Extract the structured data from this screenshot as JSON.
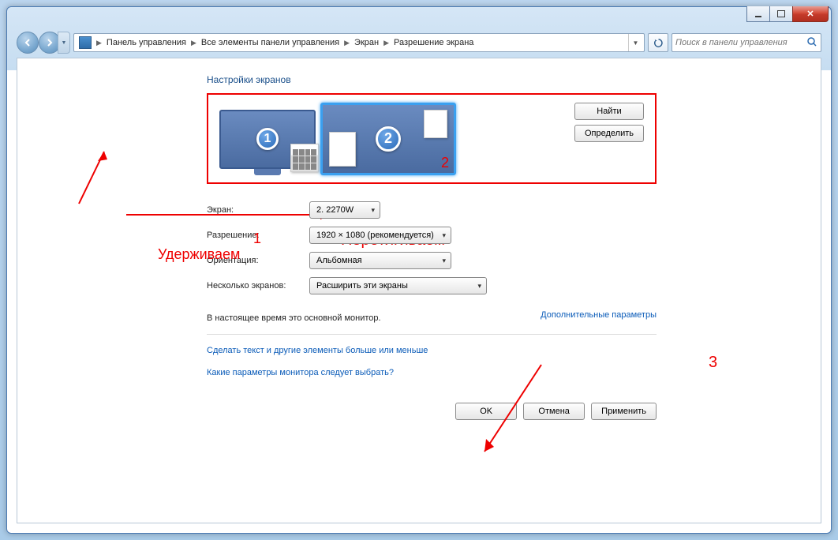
{
  "breadcrumb": {
    "items": [
      "Панель управления",
      "Все элементы панели управления",
      "Экран",
      "Разрешение экрана"
    ]
  },
  "search": {
    "placeholder": "Поиск в панели управления"
  },
  "heading": "Настройки экранов",
  "monitors": {
    "m1_num": "1",
    "m2_num": "2",
    "red2": "2"
  },
  "sidebuttons": {
    "find": "Найти",
    "identify": "Определить"
  },
  "annotations": {
    "num1": "1",
    "hold": "Удерживаем",
    "drag": "Перетягиваем",
    "num3": "3"
  },
  "form": {
    "screen_label": "Экран:",
    "screen_value": "2. 2270W",
    "res_label": "Разрешение:",
    "res_value": "1920 × 1080 (рекомендуется)",
    "orient_label": "Ориентация:",
    "orient_value": "Альбомная",
    "multi_label": "Несколько экранов:",
    "multi_value": "Расширить эти экраны"
  },
  "note_main": "В настоящее время это основной монитор.",
  "link_adv": "Дополнительные параметры",
  "link_text": "Сделать текст и другие элементы больше или меньше",
  "link_which": "Какие параметры монитора следует выбрать?",
  "buttons": {
    "ok": "OK",
    "cancel": "Отмена",
    "apply": "Применить"
  }
}
